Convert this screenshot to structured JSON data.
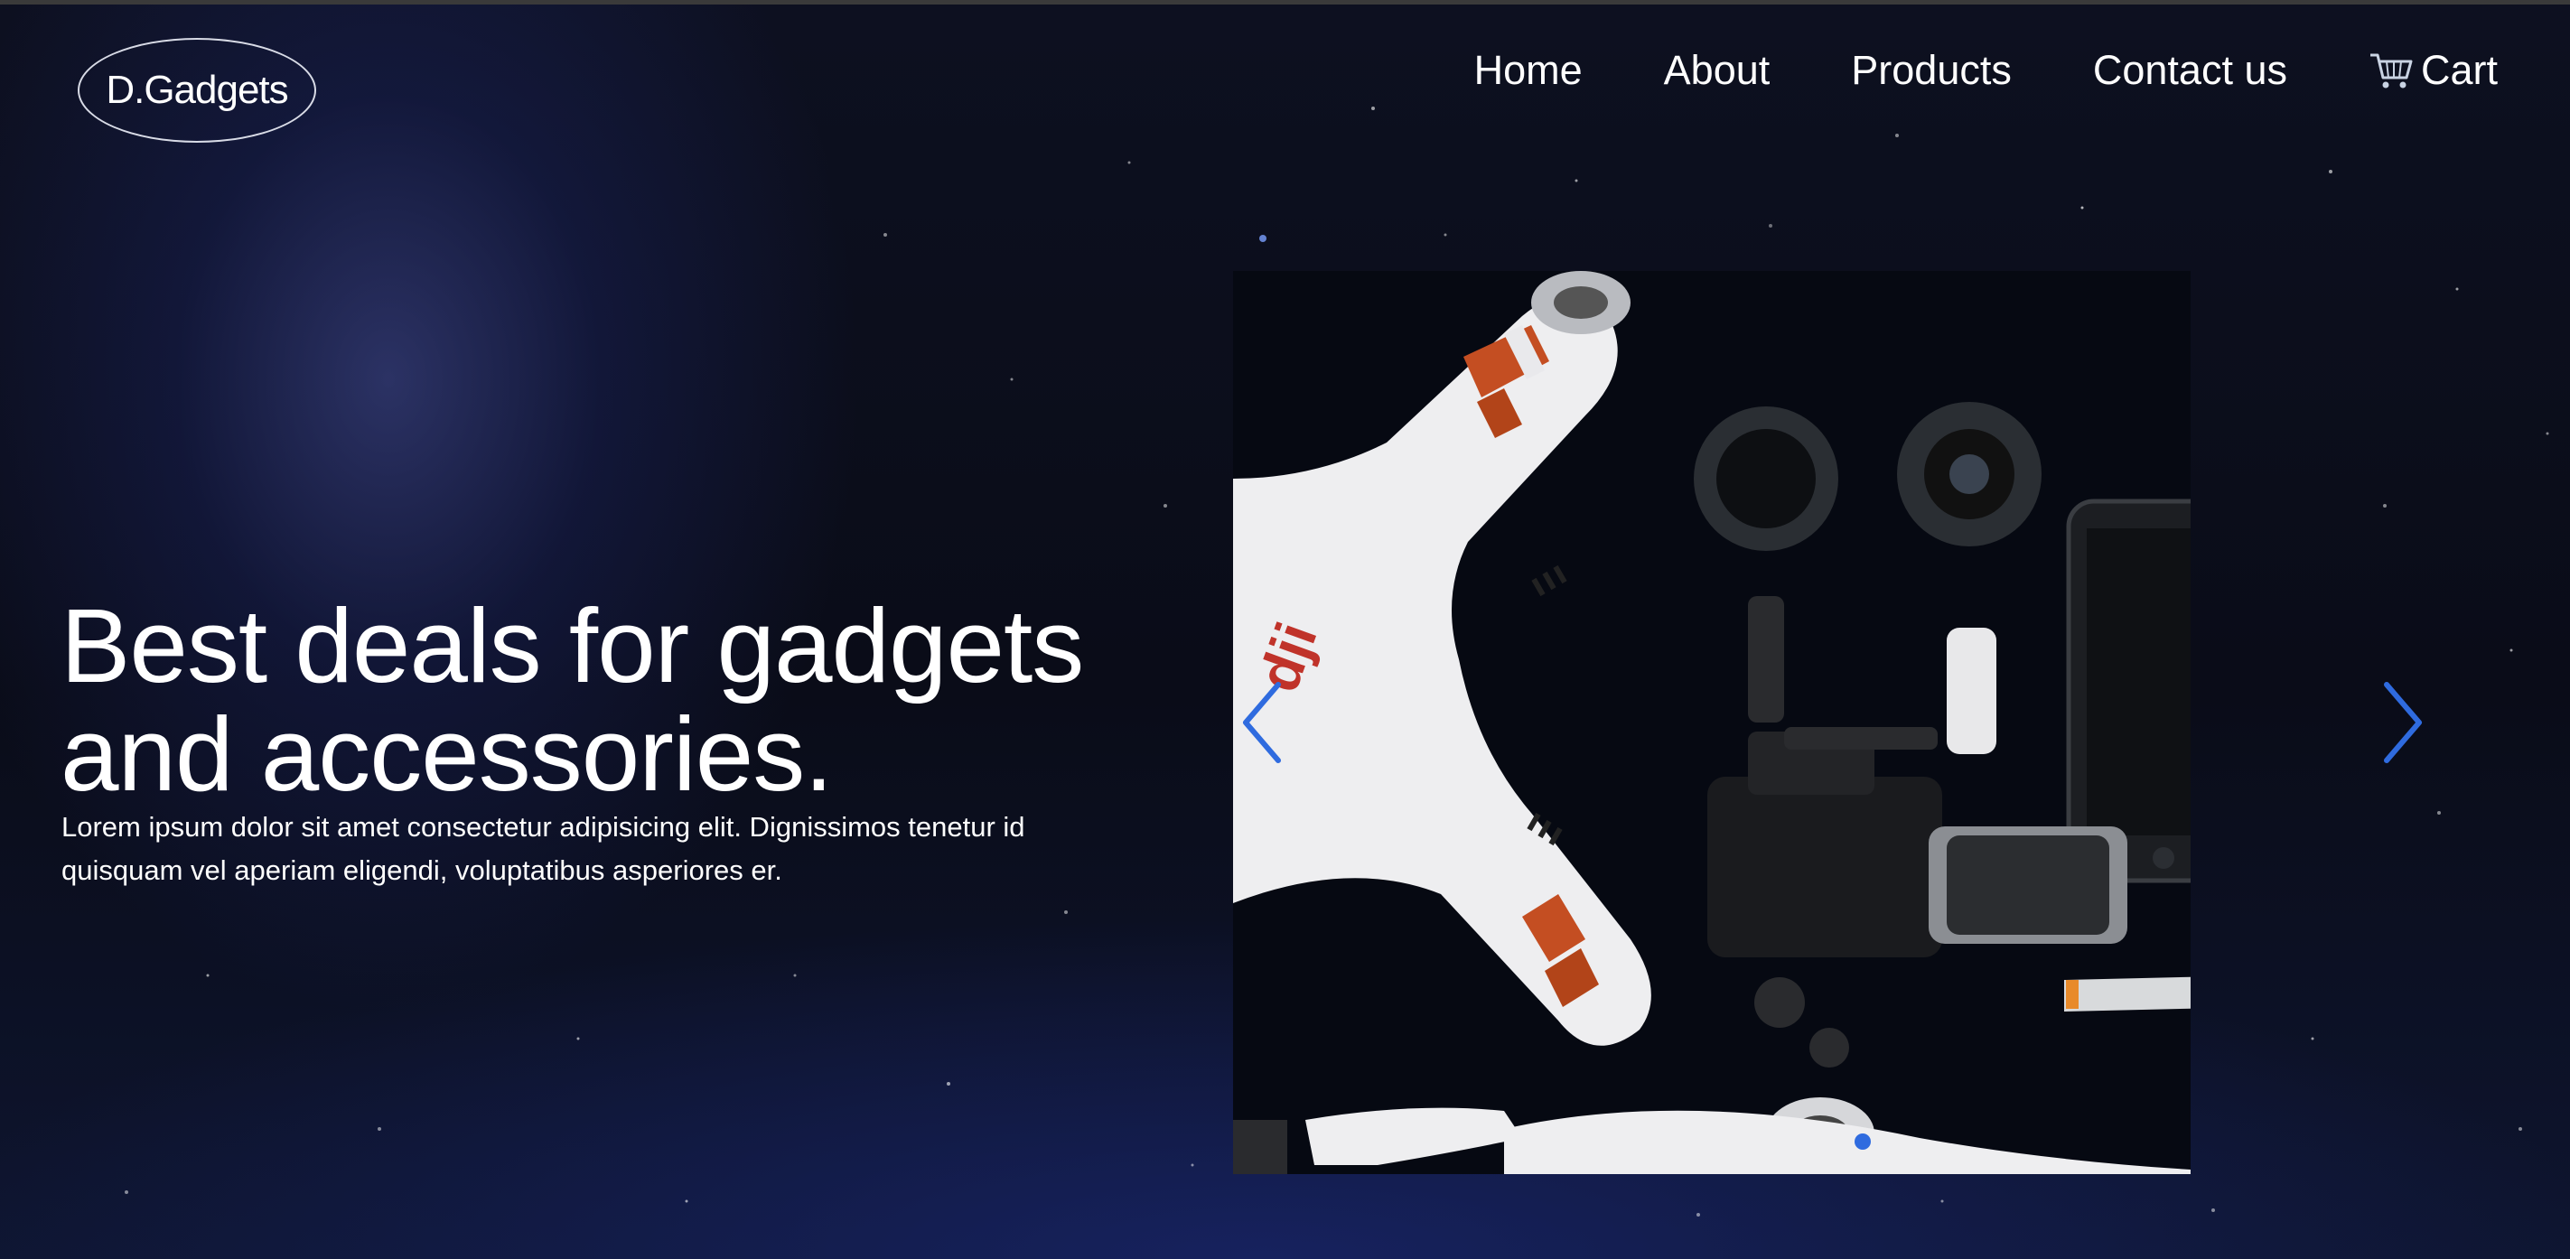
{
  "brand": {
    "name": "D.Gadgets"
  },
  "nav": {
    "items": [
      {
        "label": "Home"
      },
      {
        "label": "About"
      },
      {
        "label": "Products"
      },
      {
        "label": "Contact us"
      }
    ],
    "cart": {
      "label": "Cart",
      "icon": "cart-icon"
    }
  },
  "hero": {
    "title_line1": "Best deals for gadgets",
    "title_line2": "and accessories.",
    "description": "Lorem ipsum dolor sit amet consectetur adipisicing elit. Dignissimos tenetur id quisquam vel aperiam eligendi, voluptatibus asperiores er."
  },
  "carousel": {
    "slide_brand": "dji",
    "prev_icon": "chevron-left-icon",
    "next_icon": "chevron-right-icon",
    "active_slide": 1,
    "slide_count": 1
  },
  "colors": {
    "accent": "#2f6bdf",
    "background": "#0a0d1a",
    "text": "#ffffff"
  }
}
